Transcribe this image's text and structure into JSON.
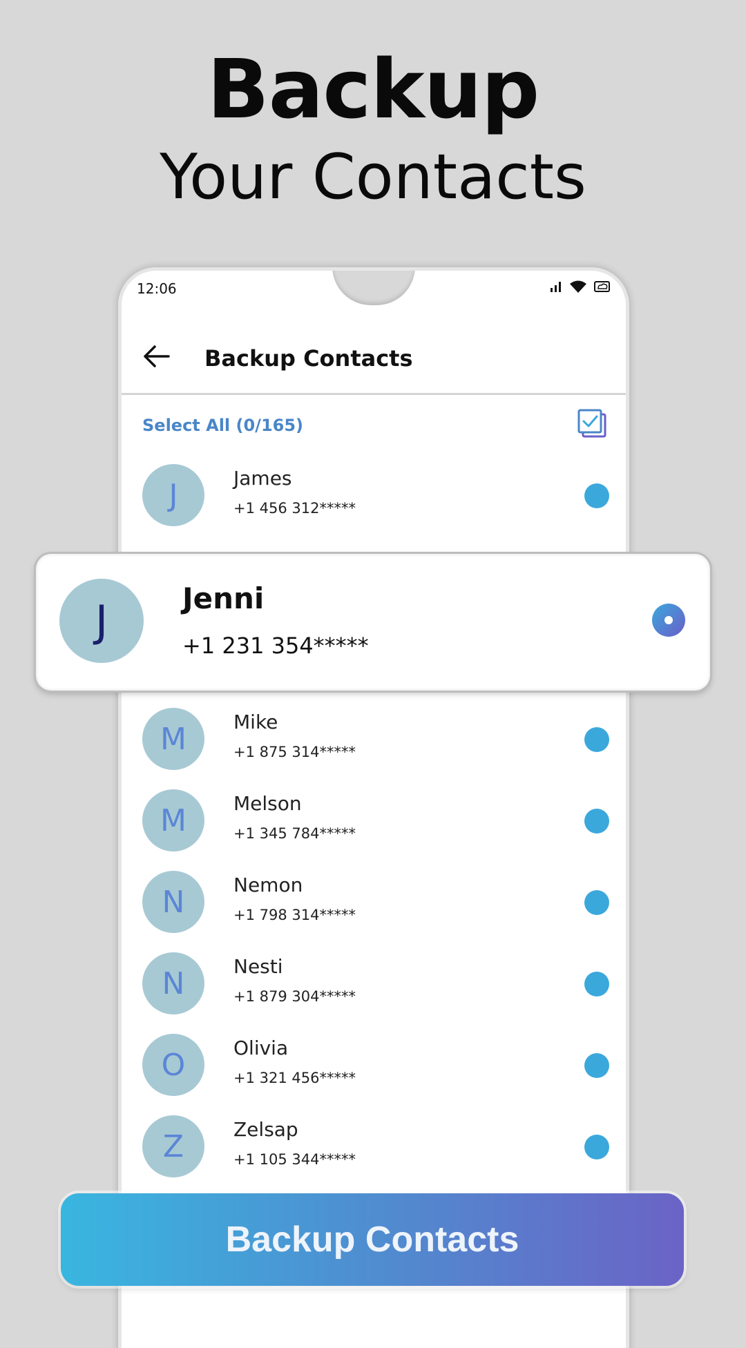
{
  "hero": {
    "title": "Backup",
    "subtitle": "Your Contacts"
  },
  "status_bar": {
    "time": "12:06",
    "icons": [
      "signal-icon",
      "wifi-icon",
      "battery-icon"
    ]
  },
  "app_bar": {
    "title": "Backup Contacts",
    "back_icon": "arrow-left-icon"
  },
  "select_all": {
    "label": "Select All (0/165)",
    "icon": "select-all-checkbox-icon"
  },
  "contacts": [
    {
      "initial": "J",
      "name": "James",
      "phone": "+1 456 312*****"
    },
    {
      "initial": "M",
      "name": "Mike",
      "phone": "+1 875 314*****"
    },
    {
      "initial": "M",
      "name": "Melson",
      "phone": "+1 345 784*****"
    },
    {
      "initial": "N",
      "name": "Nemon",
      "phone": "+1 798 314*****"
    },
    {
      "initial": "N",
      "name": "Nesti",
      "phone": "+1 879 304*****"
    },
    {
      "initial": "O",
      "name": "Olivia",
      "phone": "+1 321 456*****"
    },
    {
      "initial": "Z",
      "name": "Zelsap",
      "phone": "+1 105 344*****"
    }
  ],
  "highlight": {
    "initial": "J",
    "name": "Jenni",
    "phone": "+1 231 354*****"
  },
  "cta": {
    "label": "Backup Contacts"
  },
  "colors": {
    "background": "#d8d8d8",
    "accent_blue": "#3ba8dc",
    "accent_purple": "#6b63c6",
    "avatar_bg": "#a7c9d4",
    "link_blue": "#4a86c8"
  }
}
